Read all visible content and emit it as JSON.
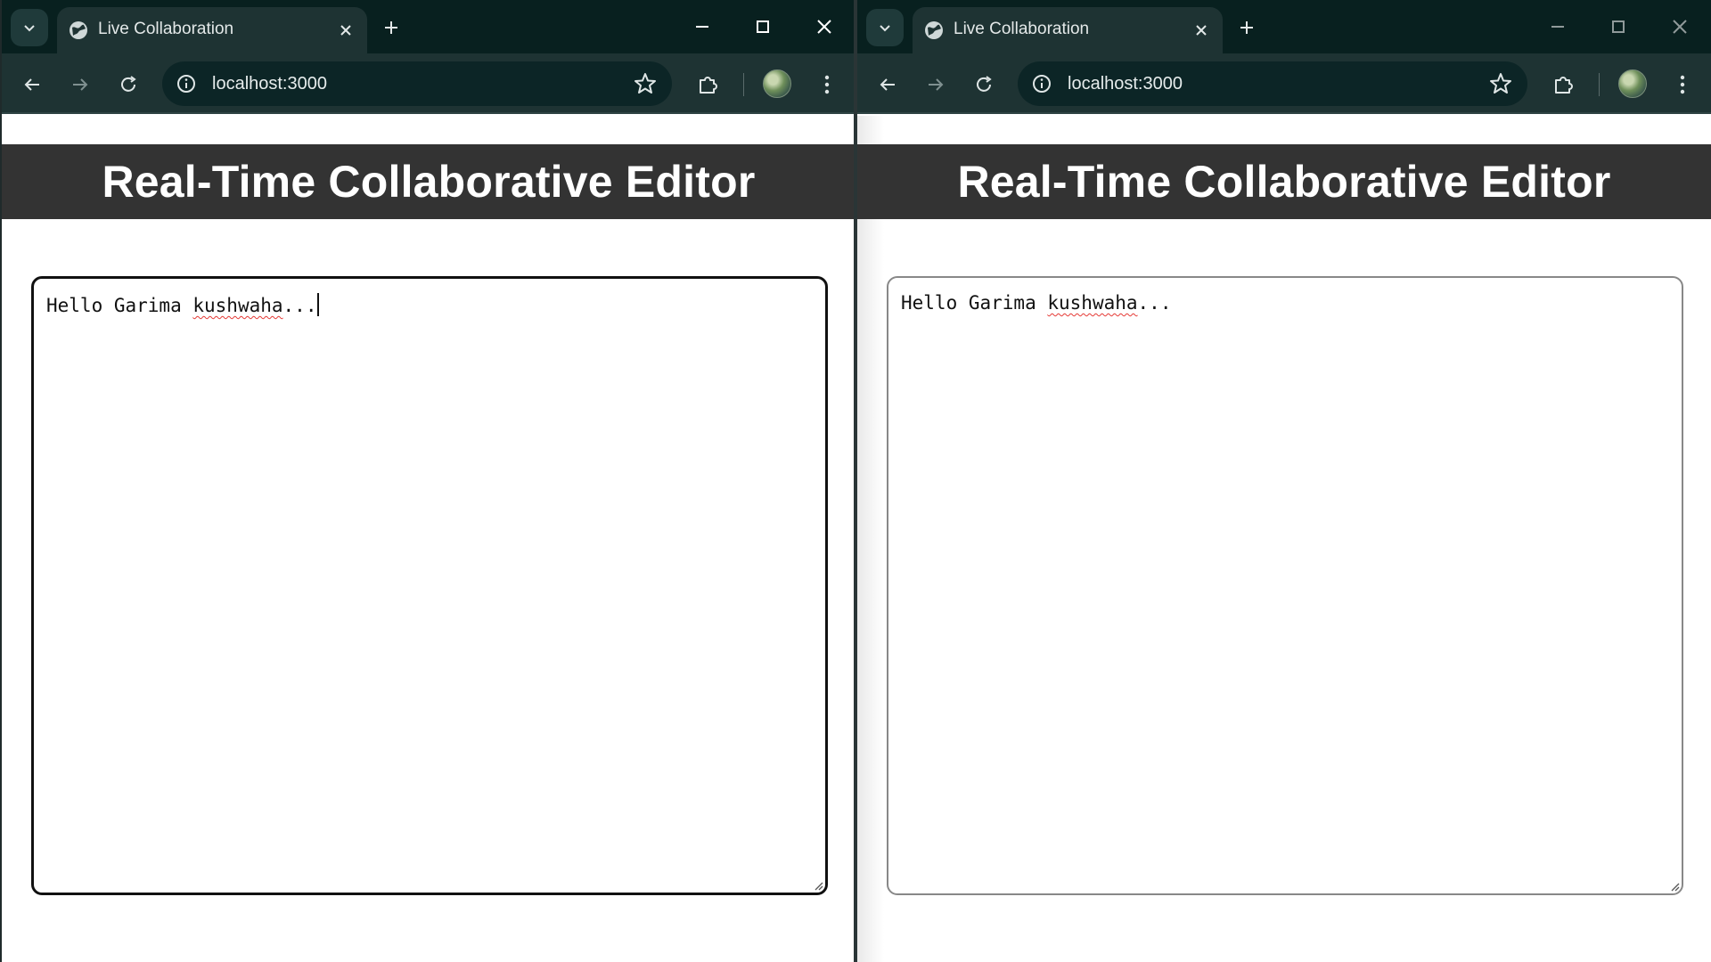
{
  "windows": [
    {
      "tab_title": "Live Collaboration",
      "url": "localhost:3000",
      "page_title": "Real-Time Collaborative Editor",
      "editor_text_before": "Hello Garima ",
      "editor_misspelled": "kushwaha",
      "editor_text_after": "...",
      "focused": true
    },
    {
      "tab_title": "Live Collaboration",
      "url": "localhost:3000",
      "page_title": "Real-Time Collaborative Editor",
      "editor_text_before": "Hello Garima ",
      "editor_misspelled": "kushwaha",
      "editor_text_after": "...",
      "focused": false
    }
  ],
  "icons": {
    "tab_search": "chevron-down-icon",
    "favicon": "globe-icon",
    "close_tab": "close-icon",
    "new_tab": "plus-icon",
    "minimize": "minimize-icon",
    "maximize": "maximize-icon",
    "close_window": "close-icon",
    "back": "arrow-left-icon",
    "forward": "arrow-right-icon",
    "reload": "reload-icon",
    "site_info": "info-icon",
    "bookmark": "star-icon",
    "extensions": "puzzle-icon",
    "profile": "avatar",
    "menu": "kebab-icon"
  },
  "colors": {
    "tabstrip": "#08201f",
    "toolbar": "#1e3333",
    "header": "#333333",
    "header_text": "#ffffff"
  }
}
